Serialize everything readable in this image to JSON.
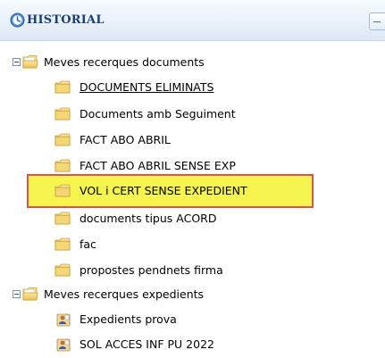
{
  "panel": {
    "title": "HISTORIAL"
  },
  "tree": {
    "documents": {
      "label": "Meves recerques documents",
      "items": [
        "DOCUMENTS ELIMINATS",
        "Documents amb Seguiment",
        "FACT ABO ABRIL",
        "FACT ABO ABRIL SENSE EXP",
        "VOL i CERT SENSE EXPEDIENT",
        "documents tipus ACORD",
        "fac",
        "propostes pendnets firma"
      ]
    },
    "expedients": {
      "label": "Meves recerques expedients",
      "items": [
        "Expedients prova",
        "SOL ACCES INF PU 2022"
      ]
    }
  },
  "colors": {
    "highlight_fill": "#f6f54f",
    "highlight_border": "#d9534f",
    "header_text": "#1b3f73",
    "folder": "#f2d26f"
  }
}
